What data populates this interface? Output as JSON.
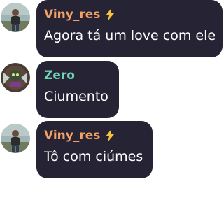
{
  "messages": [
    {
      "user": "Viny_res",
      "name_color": "#f4a263",
      "badge_icon": "lightning-bolt-icon",
      "avatar": "photo-avatar-person",
      "text": "Agora tá um love com ele"
    },
    {
      "user": "Zero",
      "name_color": "#6fd2b4",
      "badge_icon": "",
      "avatar": "character-avatar",
      "text": "Ciumento"
    },
    {
      "user": "Viny_res",
      "name_color": "#f4a263",
      "badge_icon": "lightning-bolt-icon",
      "avatar": "photo-avatar-person",
      "text": "Tô com ciúmes"
    }
  ],
  "colors": {
    "bubble_bg": "#262334",
    "badge": "#f6c23a"
  }
}
